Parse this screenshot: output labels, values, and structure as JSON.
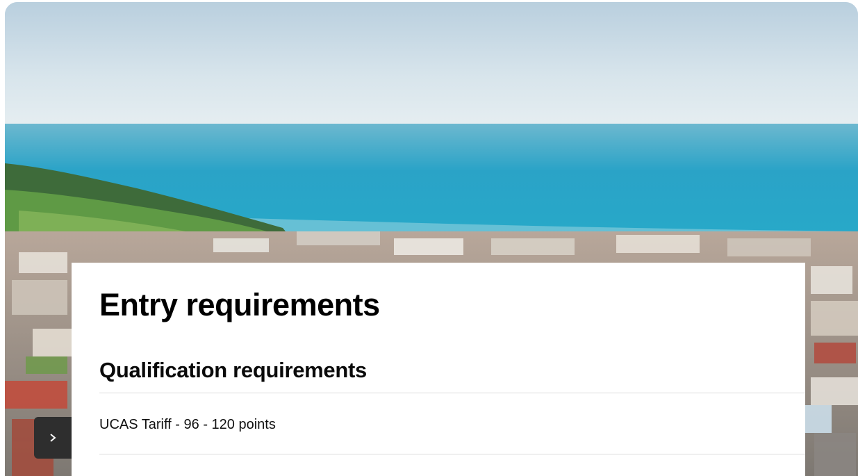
{
  "hero": {
    "image": "coastal-town-sea-view"
  },
  "nav": {
    "next_icon": "chevron-right-icon"
  },
  "entry": {
    "title": "Entry requirements",
    "section_title": "Qualification requirements",
    "items": [
      {
        "label": "UCAS Tariff - 96 - 120 points"
      }
    ]
  },
  "colors": {
    "sea": "#2aa3c7",
    "sky": "#cfe0ea",
    "panel_bg": "#ffffff",
    "toggle_bg": "#2e2e2e"
  }
}
